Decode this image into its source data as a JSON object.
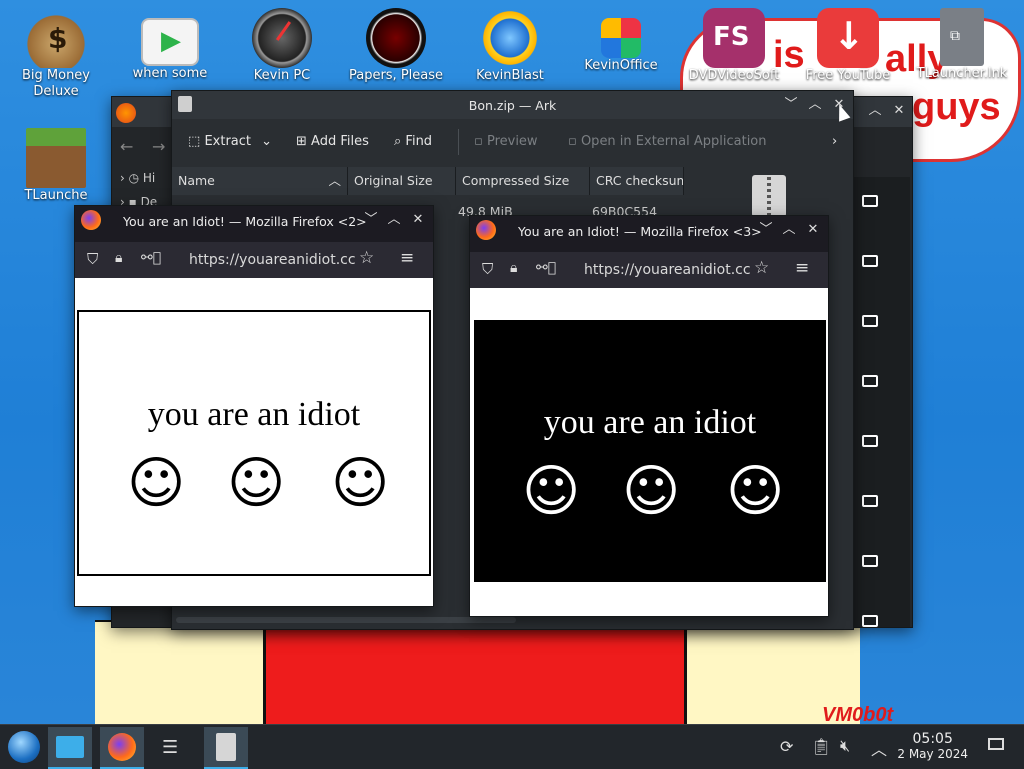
{
  "desktop": {
    "icons": [
      {
        "label": "Big Money\nDeluxe",
        "icon": "money-bag-icon"
      },
      {
        "label": "when some",
        "icon": "video-player-icon"
      },
      {
        "label": "Kevin PC",
        "icon": "speedometer-icon"
      },
      {
        "label": "Papers, Please",
        "icon": "papers-please-icon"
      },
      {
        "label": "KevinBlast",
        "icon": "globe-burst-icon"
      },
      {
        "label": "KevinOffice",
        "icon": "office-icon"
      },
      {
        "label": "DVDVideoSoft",
        "icon": "fs-icon"
      },
      {
        "label": "Free YouTube",
        "icon": "download-icon"
      },
      {
        "label": "TLauncher.lnk",
        "icon": "file-icon"
      },
      {
        "label": "TLaunche",
        "icon": "minecraft-block-icon"
      }
    ],
    "fs_badge": "FS",
    "bubble_words": [
      "is",
      "ally",
      "guys"
    ],
    "signature": "VM0b0t"
  },
  "ark": {
    "title": "Bon.zip — Ark",
    "toolbar": {
      "extract": "Extract",
      "add_files": "Add Files",
      "find": "Find",
      "preview": "Preview",
      "open_external": "Open in External Application"
    },
    "columns": [
      "Name",
      "Original Size",
      "Compressed Size",
      "CRC checksum"
    ],
    "row": {
      "compressed": "49.8 MiB",
      "crc": "69B0C554"
    }
  },
  "dolphin": {
    "sidebar": [
      "Hi",
      "De"
    ]
  },
  "firefox2": {
    "title": "You are an Idiot! — Mozilla Firefox <2>",
    "url": "https://youareanidiot.cc",
    "page_text": "you are an idiot",
    "theme": "light"
  },
  "firefox3": {
    "title": "You are an Idiot! — Mozilla Firefox <3>",
    "url": "https://youareanidiot.cc",
    "page_text": "you are an idiot",
    "theme": "dark"
  },
  "taskbar": {
    "time": "05:05",
    "date": "2 May 2024"
  },
  "colors": {
    "accent": "#3daee9",
    "window_bg": "#2a2e32",
    "titlebar": "#31363b",
    "desktop_blue": "#1f7fd6",
    "art_red": "#ee1c1c"
  }
}
